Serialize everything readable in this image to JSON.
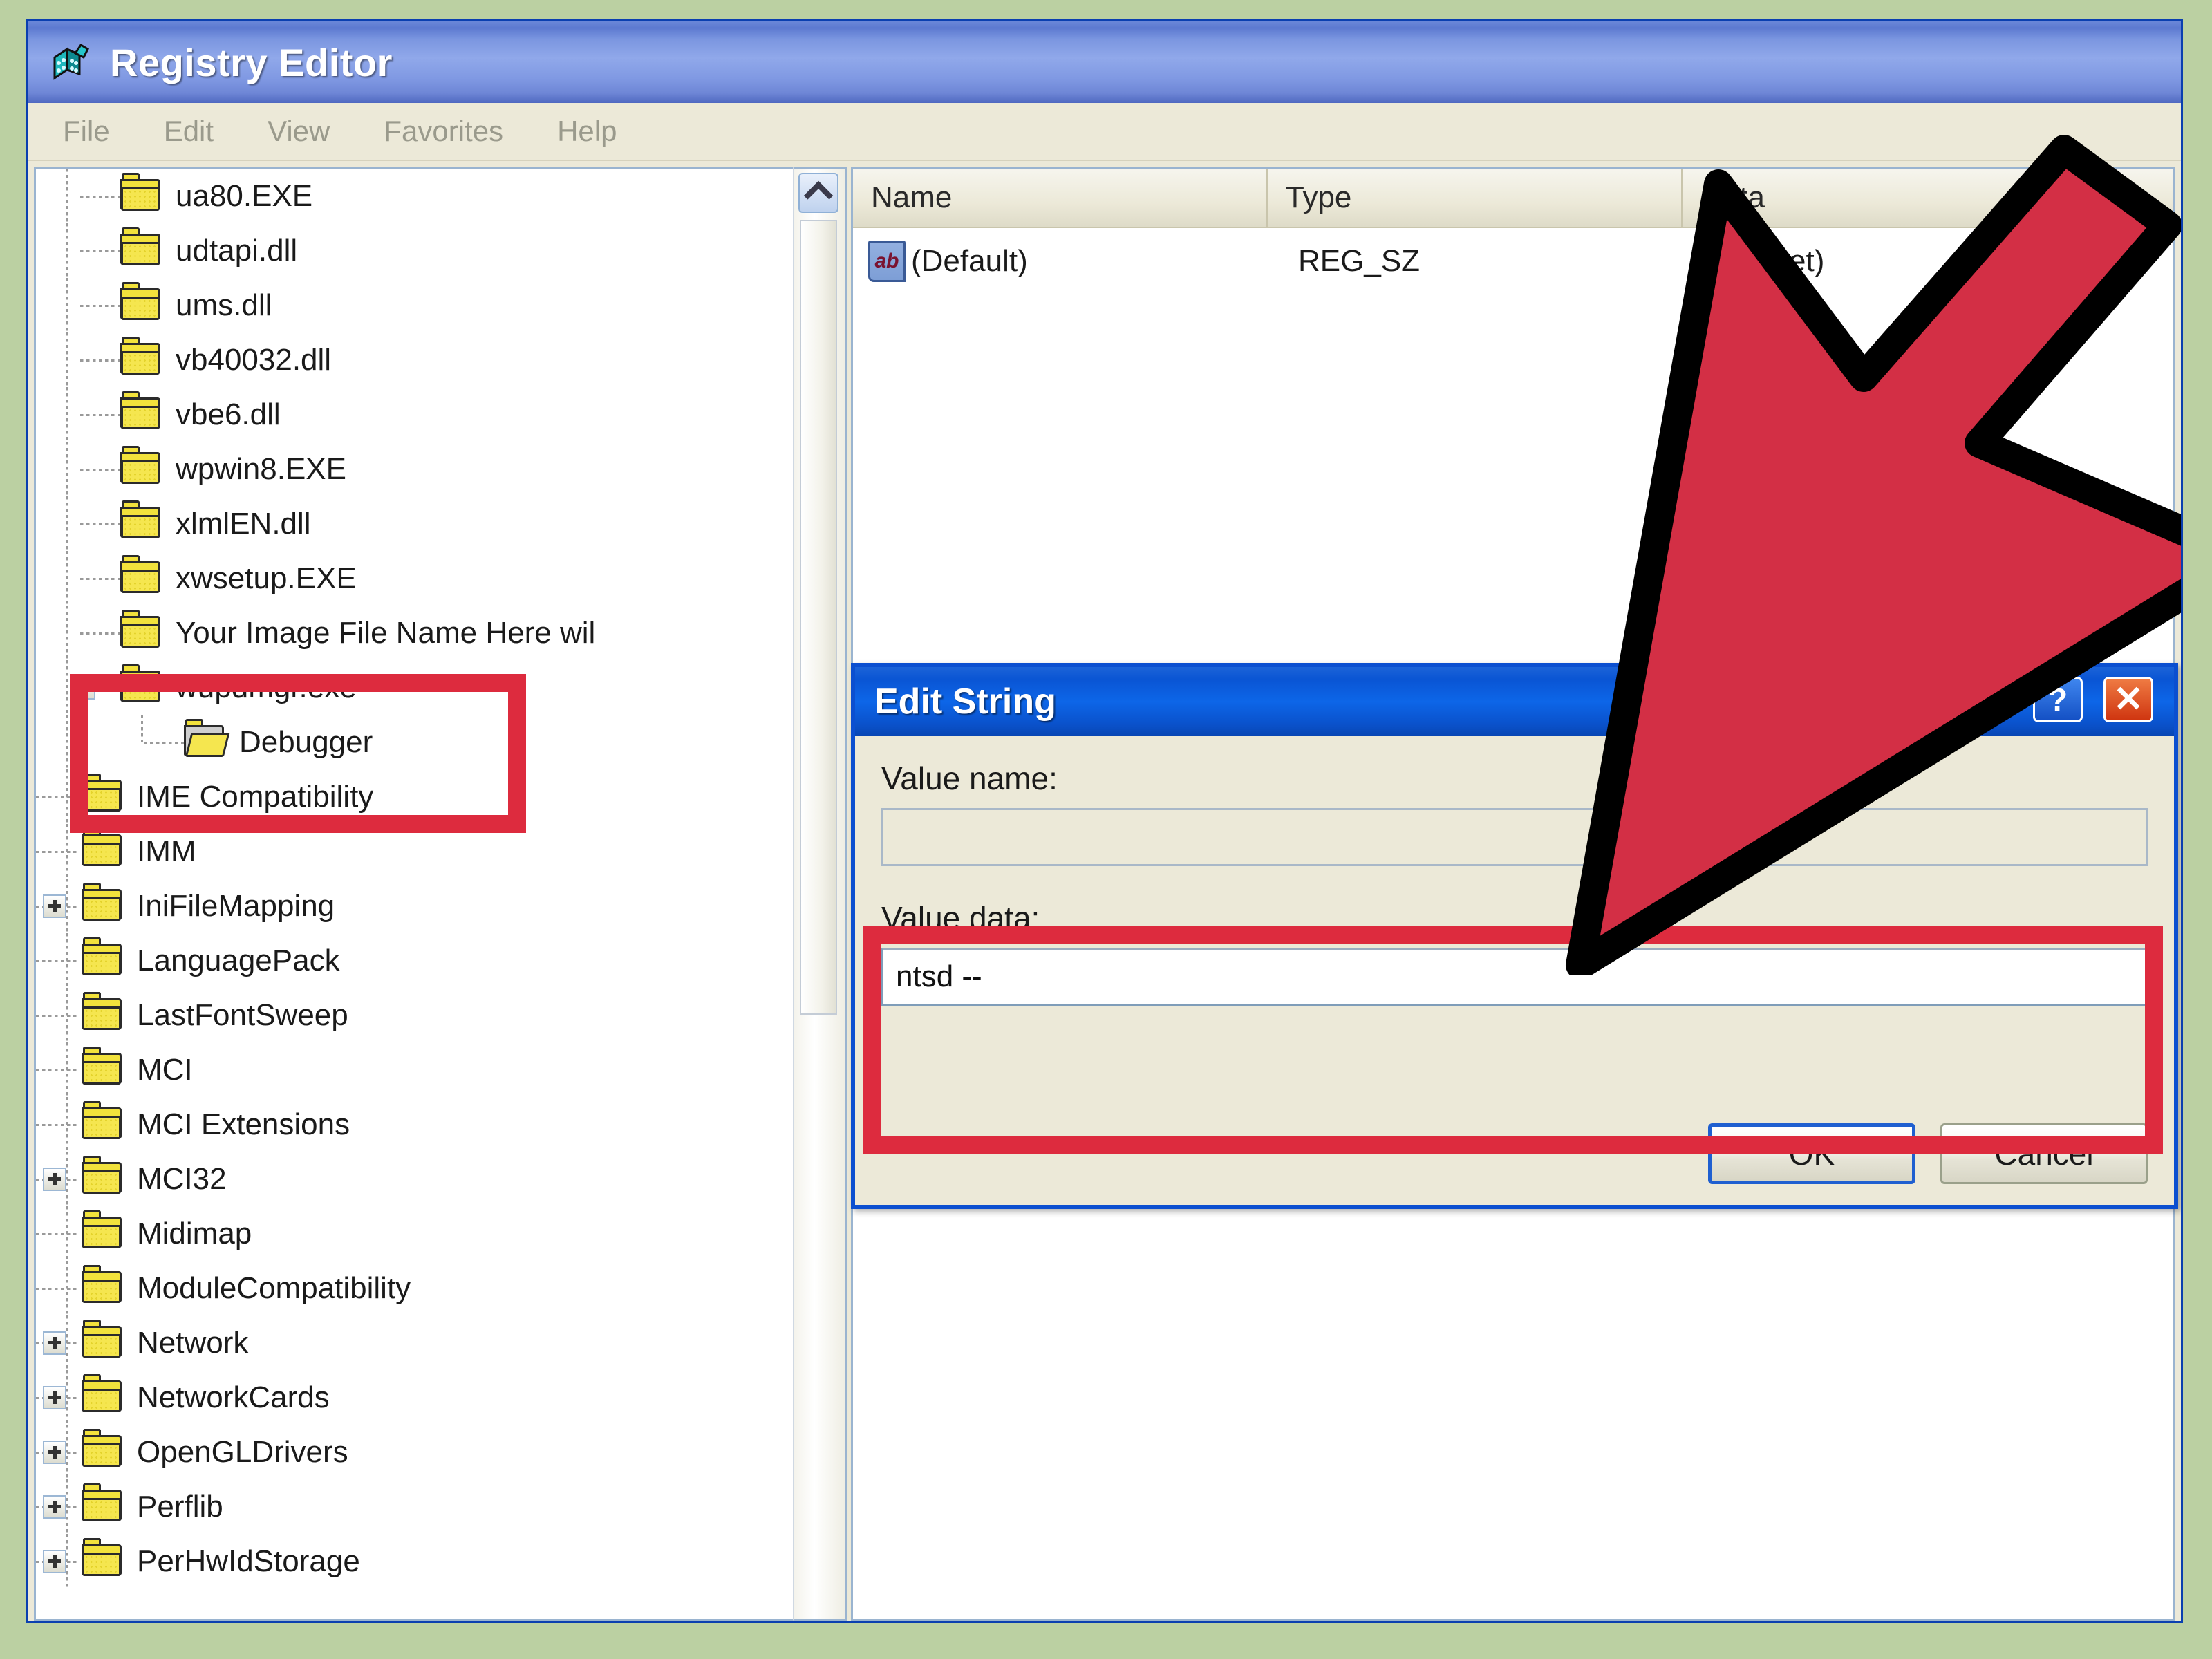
{
  "window": {
    "title": "Registry Editor",
    "icon": "registry-editor-icon",
    "accent_titlebar": "#7b96e0",
    "border_color": "#0a3fb0",
    "page_background": "#bbd0a2"
  },
  "menu": {
    "items": [
      "File",
      "Edit",
      "View",
      "Favorites",
      "Help"
    ]
  },
  "tree": {
    "scroll_up_icon": "chevron-up-icon",
    "items": [
      {
        "label": "ua80.EXE",
        "indent": 1,
        "toggle": "none",
        "open": false
      },
      {
        "label": "udtapi.dll",
        "indent": 1,
        "toggle": "none",
        "open": false
      },
      {
        "label": "ums.dll",
        "indent": 1,
        "toggle": "none",
        "open": false
      },
      {
        "label": "vb40032.dll",
        "indent": 1,
        "toggle": "none",
        "open": false
      },
      {
        "label": "vbe6.dll",
        "indent": 1,
        "toggle": "none",
        "open": false
      },
      {
        "label": "wpwin8.EXE",
        "indent": 1,
        "toggle": "none",
        "open": false
      },
      {
        "label": "xlmlEN.dll",
        "indent": 1,
        "toggle": "none",
        "open": false
      },
      {
        "label": "xwsetup.EXE",
        "indent": 1,
        "toggle": "none",
        "open": false
      },
      {
        "label": "Your Image File Name Here wil",
        "indent": 1,
        "toggle": "none",
        "open": false
      },
      {
        "label": "wupdmgr.exe",
        "indent": 1,
        "toggle": "minus",
        "open": false
      },
      {
        "label": "Debugger",
        "indent": 2,
        "toggle": "none",
        "open": true
      },
      {
        "label": "IME Compatibility",
        "indent": 0,
        "toggle": "none",
        "open": false
      },
      {
        "label": "IMM",
        "indent": 0,
        "toggle": "none",
        "open": false
      },
      {
        "label": "IniFileMapping",
        "indent": 0,
        "toggle": "plus",
        "open": false
      },
      {
        "label": "LanguagePack",
        "indent": 0,
        "toggle": "none",
        "open": false
      },
      {
        "label": "LastFontSweep",
        "indent": 0,
        "toggle": "none",
        "open": false
      },
      {
        "label": "MCI",
        "indent": 0,
        "toggle": "none",
        "open": false
      },
      {
        "label": "MCI Extensions",
        "indent": 0,
        "toggle": "none",
        "open": false
      },
      {
        "label": "MCI32",
        "indent": 0,
        "toggle": "plus",
        "open": false
      },
      {
        "label": "Midimap",
        "indent": 0,
        "toggle": "none",
        "open": false
      },
      {
        "label": "ModuleCompatibility",
        "indent": 0,
        "toggle": "none",
        "open": false
      },
      {
        "label": "Network",
        "indent": 0,
        "toggle": "plus",
        "open": false
      },
      {
        "label": "NetworkCards",
        "indent": 0,
        "toggle": "plus",
        "open": false
      },
      {
        "label": "OpenGLDrivers",
        "indent": 0,
        "toggle": "plus",
        "open": false
      },
      {
        "label": "Perflib",
        "indent": 0,
        "toggle": "plus",
        "open": false
      },
      {
        "label": "PerHwIdStorage",
        "indent": 0,
        "toggle": "plus",
        "open": false
      }
    ]
  },
  "list": {
    "columns": [
      "Name",
      "Type",
      "Data"
    ],
    "rows": [
      {
        "icon": "ab-string-value-icon",
        "name": "(Default)",
        "type": "REG_SZ",
        "data": "(not set)"
      }
    ]
  },
  "dialog": {
    "title": "Edit String",
    "help_button": "?",
    "close_button": "✕",
    "value_name_label": "Value name:",
    "value_name": "",
    "value_data_label": "Value data:",
    "value_data": "ntsd --",
    "ok_label": "OK",
    "cancel_label": "Cancel"
  },
  "annotations": {
    "highlight_color": "#dd2b3e",
    "arrow_fill": "#d32f45",
    "arrow_outline": "#000000",
    "tree_highlight_target": "wupdmgr.exe / Debugger",
    "value_highlight_target": "Value data: ntsd --"
  }
}
